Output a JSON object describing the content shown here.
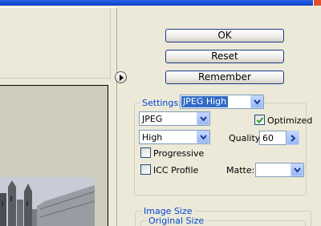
{
  "buttons": {
    "ok_label": "OK",
    "reset_label": "Reset",
    "remember_label": "Remember"
  },
  "settings": {
    "legend": "Settings:",
    "preset_value": "JPEG High",
    "format_value": "JPEG",
    "quality_preset_value": "High",
    "optimized_label": "Optimized",
    "optimized_checked": true,
    "quality_label": "Quality:",
    "quality_value": "60",
    "progressive_label": "Progressive",
    "progressive_checked": false,
    "icc_label": "ICC Profile",
    "icc_checked": false,
    "matte_label": "Matte:",
    "matte_value": ""
  },
  "image_size": {
    "legend": "Image Size",
    "original_legend": "Original Size"
  },
  "colors": {
    "accent": "#0046d5",
    "selection": "#316ac5",
    "check": "#21a121"
  }
}
